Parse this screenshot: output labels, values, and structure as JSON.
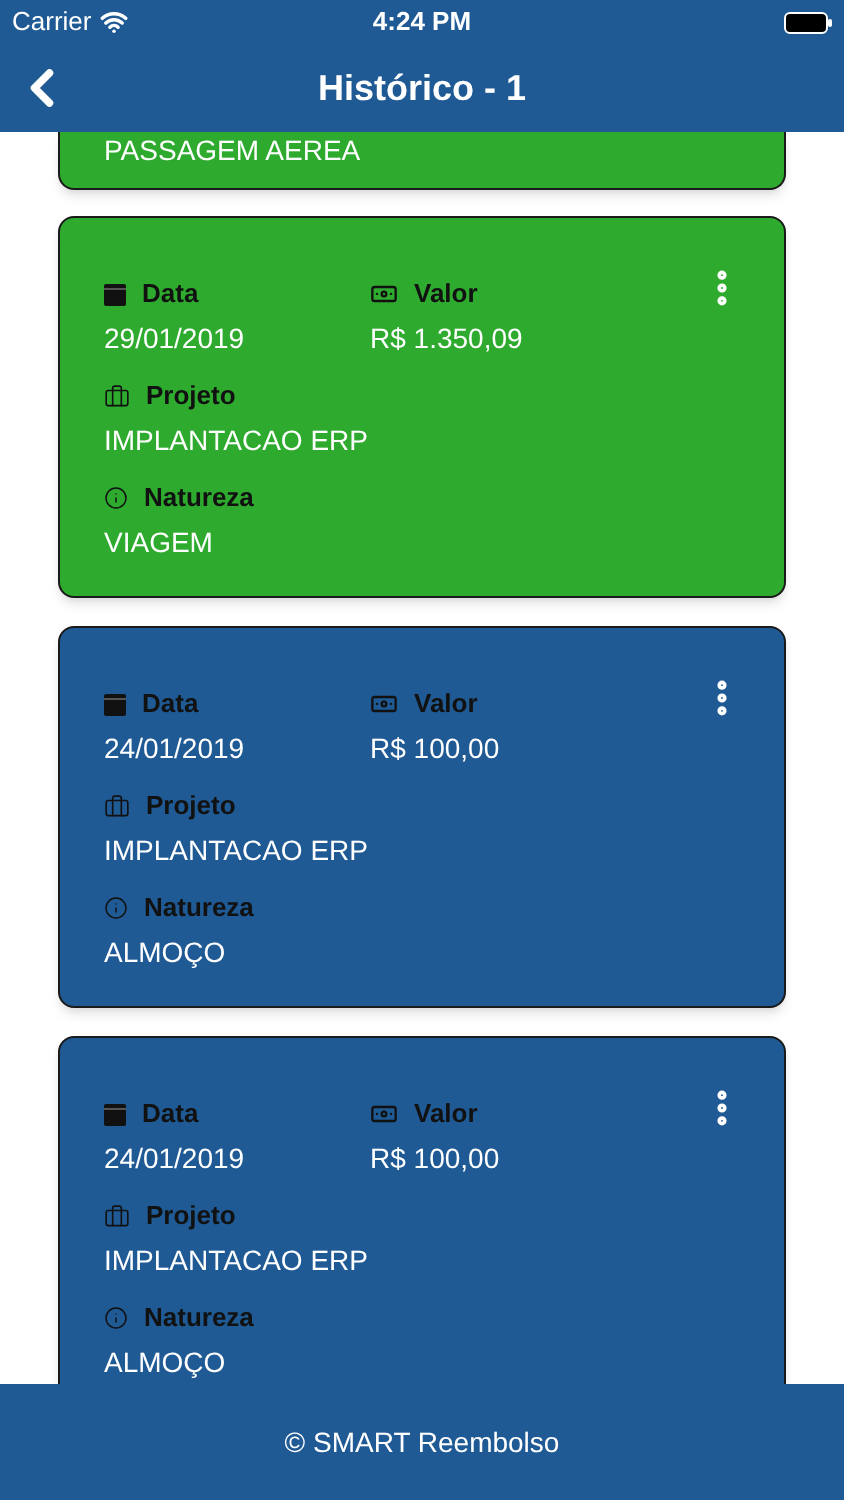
{
  "status_bar": {
    "carrier": "Carrier",
    "time": "4:24 PM"
  },
  "header": {
    "title": "Histórico - 1"
  },
  "cards": [
    {
      "kind": "partial",
      "color": "#2eab2e",
      "natureza_value": "PASSAGEM AEREA"
    },
    {
      "kind": "full",
      "color": "#2eab2e",
      "data_label": "Data",
      "data_value": "29/01/2019",
      "valor_label": "Valor",
      "valor_value": "R$ 1.350,09",
      "projeto_label": "Projeto",
      "projeto_value": "IMPLANTACAO ERP",
      "natureza_label": "Natureza",
      "natureza_value": "VIAGEM"
    },
    {
      "kind": "full",
      "color": "#1f5a94",
      "data_label": "Data",
      "data_value": "24/01/2019",
      "valor_label": "Valor",
      "valor_value": "R$ 100,00",
      "projeto_label": "Projeto",
      "projeto_value": "IMPLANTACAO ERP",
      "natureza_label": "Natureza",
      "natureza_value": "ALMOÇO"
    },
    {
      "kind": "full",
      "color": "#1f5a94",
      "data_label": "Data",
      "data_value": "24/01/2019",
      "valor_label": "Valor",
      "valor_value": "R$ 100,00",
      "projeto_label": "Projeto",
      "projeto_value": "IMPLANTACAO ERP",
      "natureza_label": "Natureza",
      "natureza_value": "ALMOÇO"
    }
  ],
  "footer": {
    "text": "© SMART Reembolso"
  }
}
